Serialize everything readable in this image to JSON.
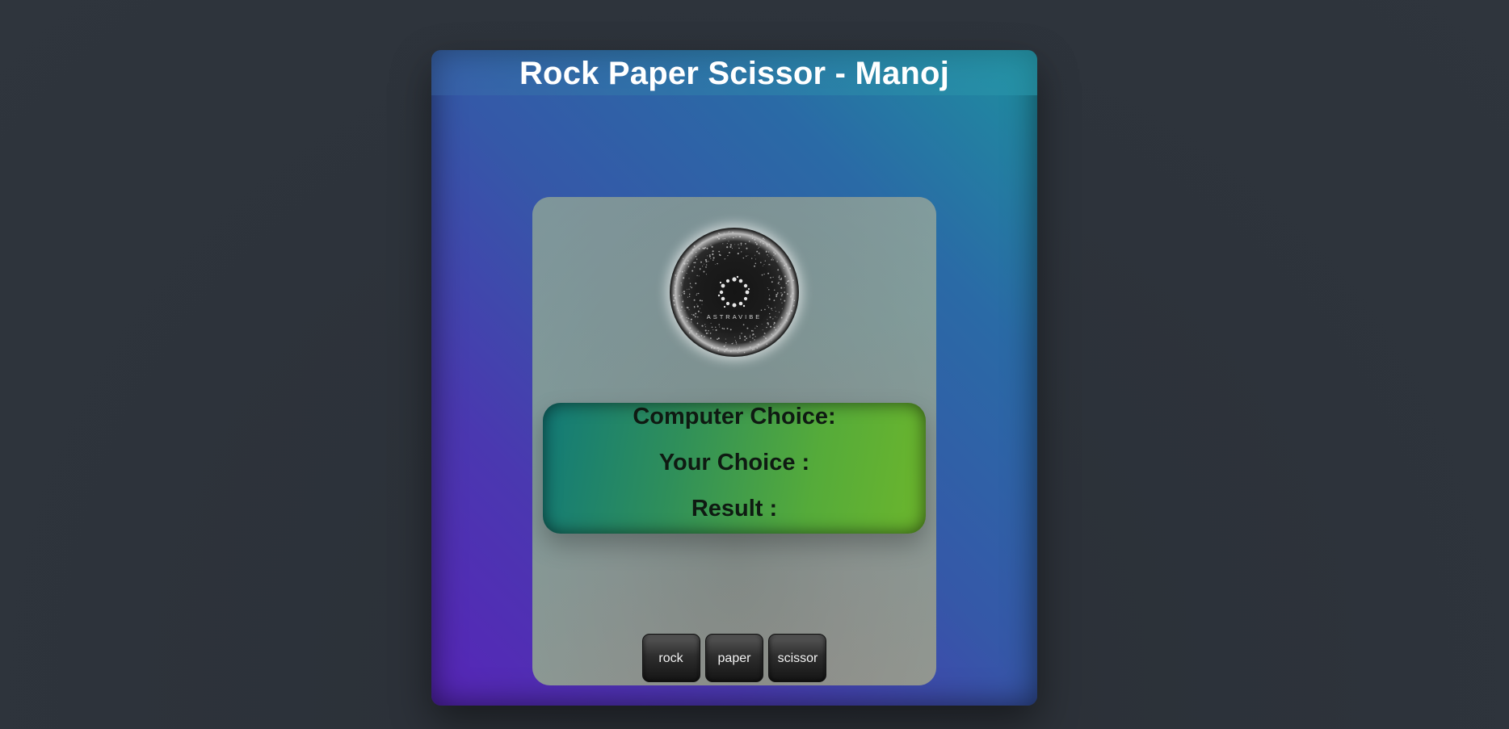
{
  "header": {
    "title": "Rock Paper Scissor - Manoj"
  },
  "logo": {
    "icon": "astravibe-logo",
    "text": "ASTRAVIBE"
  },
  "status": {
    "computer_choice_label": "Computer Choice:",
    "your_choice_label": "Your Choice :",
    "result_label": "Result :"
  },
  "controls": {
    "rock_label": "rock",
    "paper_label": "paper",
    "scissor_label": "scissor"
  },
  "colors": {
    "page_background": "#2d333b",
    "frame_gradient_top_right": "#1e8f9f",
    "frame_gradient_bottom_left": "#5725b8",
    "status_gradient_left": "#127a78",
    "status_gradient_right": "#6cb62c",
    "title_text": "#ffffff",
    "button_background": "#1e1e1e"
  }
}
